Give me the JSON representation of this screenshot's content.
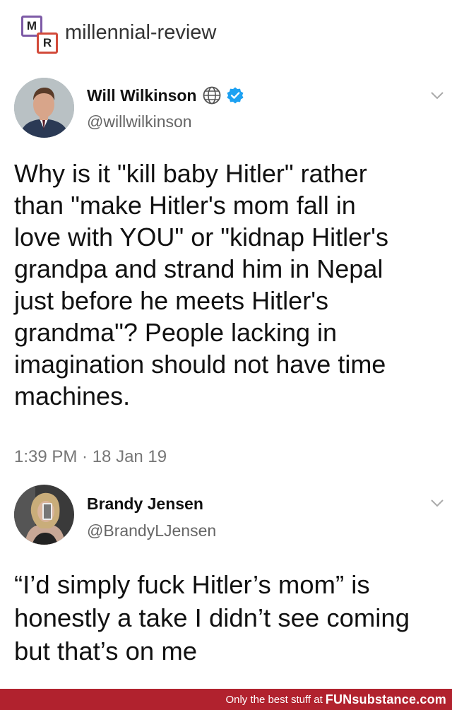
{
  "header": {
    "logo_letters": [
      "M",
      "R"
    ],
    "site_name": "millennial-review"
  },
  "tweets": [
    {
      "name": "Will Wilkinson",
      "handle": "@willwilkinson",
      "body": "Why is it \"kill baby Hitler\" rather\nthan \"make Hitler's mom fall in\nlove with YOU\" or \"kidnap Hitler's\ngrandpa and strand him in Nepal\njust before he meets Hitler's\ngrandma\"?  People lacking in\nimagination should not have time\nmachines.",
      "timestamp": "1:39 PM · 18 Jan 19",
      "badges": [
        "globe-icon",
        "verified-icon"
      ]
    },
    {
      "name": "Brandy Jensen",
      "handle": "@BrandyLJensen",
      "body": "“I’d simply fuck Hitler’s mom” is\nhonestly a take I didn’t see coming\nbut that’s on me"
    }
  ],
  "footer": {
    "text": "Only the best stuff at",
    "brand": "FUNsubstance.com"
  },
  "colors": {
    "verified": "#1da1f2",
    "footer_bg": "#b1222e",
    "logo_m": "#7d5aa6",
    "logo_r": "#d24a3a"
  }
}
